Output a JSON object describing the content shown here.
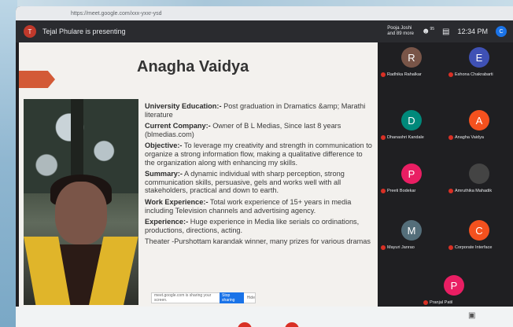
{
  "browser": {
    "url": "https://meet.google.com/xxx-yxxr-ysd"
  },
  "meet": {
    "presenter_initial": "T",
    "presenter_text": "Tejal Phulare is presenting",
    "others_line1": "Pooja Joshi",
    "others_line2": "and 89 more",
    "participants_count": "95",
    "time": "12:34 PM",
    "self_initial": "C"
  },
  "slide": {
    "title": "Anagha Vaidya",
    "items": [
      {
        "label": "University Education:-",
        "text": " Post graduation in Dramatics &amp; Marathi literature"
      },
      {
        "label": "Current Company:-",
        "text": " Owner of B L Medias, Since last 8 years (blmedias.com)"
      },
      {
        "label": "Objective:-",
        "text": " To leverage my creativity and strength in communication to organize a strong information flow, making a qualitative difference to the organization along with enhancing my skills."
      },
      {
        "label": "Summary:-",
        "text": " A dynamic individual with sharp perception, strong communication skills, persuasive, gels and works well with all stakeholders, practical and down to earth."
      },
      {
        "label": "Work Experience:-",
        "text": " Total work experience of 15+ years in media including Television channels and advertising agency."
      },
      {
        "label": "Experience:-",
        "text": " Huge experience in Media like serials co ordinations, productions, directions, acting."
      },
      {
        "label": "",
        "text": "Theater -Purshottam karandak winner, many prizes for various dramas"
      }
    ],
    "share_text": "meet.google.com is sharing your screen.",
    "share_stop": "Stop sharing",
    "share_hide": "Hide"
  },
  "participants": [
    {
      "initial": "R",
      "name": "Radhika Rahalkar",
      "color": "#795548"
    },
    {
      "initial": "E",
      "name": "Eshona Chakrabarti",
      "color": "#3f51b5"
    },
    {
      "initial": "D",
      "name": "Dhanashri Kandale",
      "color": "#00897b"
    },
    {
      "initial": "A",
      "name": "Anagha Vaidya",
      "color": "#f4511e"
    },
    {
      "initial": "P",
      "name": "Preeti Bodekar",
      "color": "#e91e63"
    },
    {
      "initial": "",
      "name": "Amruthika Mahadik",
      "color": "#444444"
    },
    {
      "initial": "M",
      "name": "Mayuri Janrao",
      "color": "#546e7a"
    },
    {
      "initial": "C",
      "name": "Corporate Interface",
      "color": "#f4511e"
    },
    {
      "initial": "P",
      "name": "Pranjal Patil",
      "color": "#e91e63"
    }
  ]
}
